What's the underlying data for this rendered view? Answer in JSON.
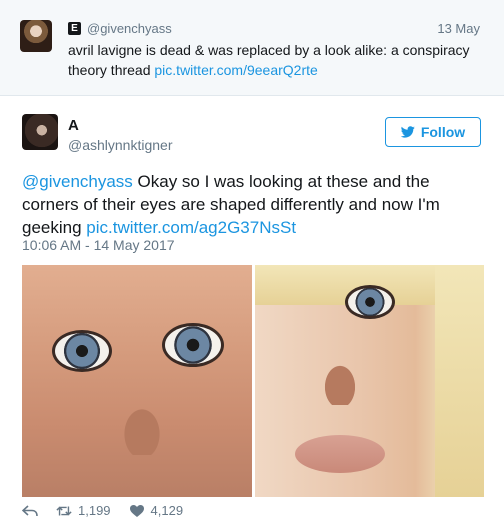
{
  "parent_tweet": {
    "badge": "E",
    "handle": "@givenchyass",
    "date": "13 May",
    "text": "avril lavigne is dead & was replaced by a look alike: a conspiracy theory thread",
    "link": "pic.twitter.com/9eearQ2rte"
  },
  "tweet": {
    "display_name": "A",
    "handle": "@ashlynnktigner",
    "follow_label": "Follow",
    "mention": "@givenchyass",
    "text": " Okay so I was looking at these and the corners of their eyes are shaped differently and now I'm geeking",
    "link": "pic.twitter.com/ag2G37NsSt",
    "timestamp": "10:06 AM - 14 May 2017",
    "retweets": "1,199",
    "likes": "4,129"
  },
  "colors": {
    "link": "#1b95e0",
    "muted": "#657786",
    "text": "#14171a",
    "parent_bg": "#f5f8fa"
  },
  "icons": {
    "reply": "reply-icon",
    "retweet": "retweet-icon",
    "like": "heart-icon",
    "follow": "twitter-bird-icon"
  }
}
